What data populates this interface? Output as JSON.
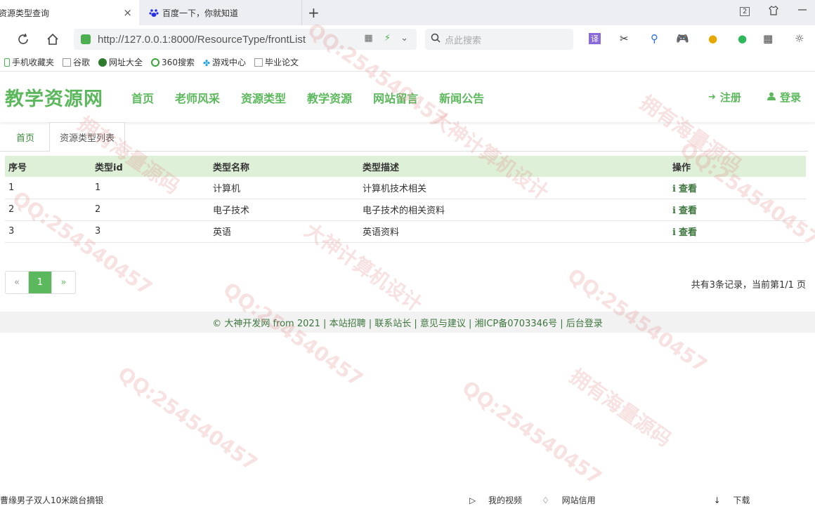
{
  "browser": {
    "tabs": [
      {
        "title": "资源类型查询",
        "close": "×"
      },
      {
        "title": "百度一下，你就知道"
      }
    ],
    "new_tab": "+",
    "tab_count": "2",
    "address": "http://127.0.0.1:8000/ResourceType/frontList",
    "search_placeholder": "点此搜索",
    "bookmarks": [
      "手机收藏夹",
      "谷歌",
      "网址大全",
      "360搜索",
      "游戏中心",
      "毕业论文"
    ]
  },
  "site": {
    "logo": "教学资源网",
    "nav": [
      "首页",
      "老师风采",
      "资源类型",
      "教学资源",
      "网站留言",
      "新闻公告"
    ],
    "register": "注册",
    "login": "登录"
  },
  "subtabs": {
    "home": "首页",
    "current": "资源类型列表"
  },
  "table": {
    "headers": [
      "序号",
      "类型id",
      "类型名称",
      "类型描述",
      "操作"
    ],
    "rows": [
      {
        "no": "1",
        "id": "1",
        "name": "计算机",
        "desc": "计算机技术相关",
        "action": "查看"
      },
      {
        "no": "2",
        "id": "2",
        "name": "电子技术",
        "desc": "电子技术的相关资料",
        "action": "查看"
      },
      {
        "no": "3",
        "id": "3",
        "name": "英语",
        "desc": "英语资料",
        "action": "查看"
      }
    ]
  },
  "pagination": {
    "prev": "«",
    "current": "1",
    "next": "»",
    "info": "共有3条记录，当前第1/1 页"
  },
  "footer": {
    "text": "© 大神开发网 from 2021 | 本站招聘 | 联系站长 | 意见与建议 | 湘ICP备0703346号 | 后台登录"
  },
  "statusbar": {
    "left": "曹缘男子双人10米跳台摘银",
    "right": [
      "我的视频",
      "网站信用",
      "下载"
    ]
  },
  "watermark": [
    "QQ:254540457",
    "大神计算机设计",
    "拥有海量源码"
  ],
  "colors": {
    "accent": "#5cb85c",
    "table_header": "#dff0d8",
    "footer_bg": "#f2f2f2"
  }
}
